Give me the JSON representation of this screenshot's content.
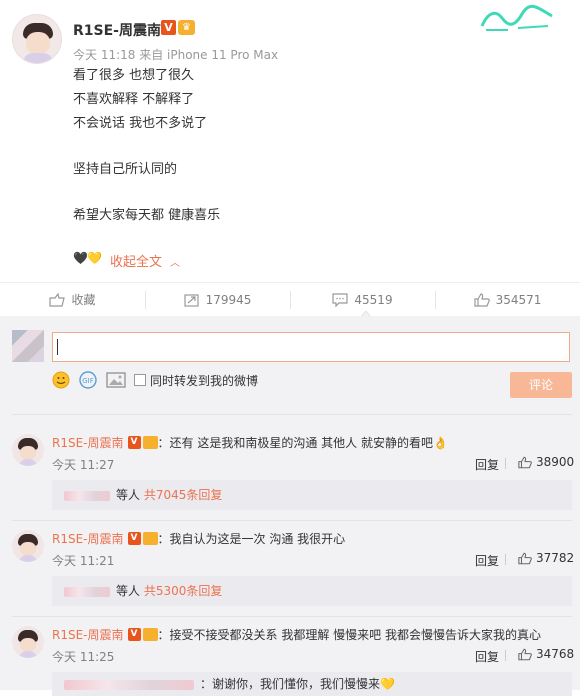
{
  "post": {
    "author": "R1SE-周震南",
    "verified_badge": "V",
    "meta": "今天 11:18 来自 iPhone 11 Pro Max",
    "lines": [
      "看了很多 也想了很久",
      "不喜欢解释 不解释了",
      "不会说话 我也不多说了",
      "",
      "坚持自己所认同的",
      "",
      "希望大家每天都 健康喜乐"
    ],
    "hearts": "🖤💛",
    "collapse_label": "收起全文"
  },
  "actions": {
    "favorite": "收藏",
    "repost": "179945",
    "comment": "45519",
    "like": "354571"
  },
  "composer": {
    "repost_label": "同时转发到我的微博",
    "submit_label": "评论"
  },
  "comments": [
    {
      "author": "R1SE-周震南",
      "text": "：还有 这是我和南极星的沟通 其他人 就安静的看吧👌",
      "time": "今天 11:27",
      "reply_label": "回复",
      "likes": "38900",
      "sub_suffix": "等人",
      "sub_count": "共7045条回复"
    },
    {
      "author": "R1SE-周震南",
      "text": "：我自认为这是一次 沟通 我很开心",
      "time": "今天 11:21",
      "reply_label": "回复",
      "likes": "37782",
      "sub_suffix": "等人",
      "sub_count": "共5300条回复"
    },
    {
      "author": "R1SE-周震南",
      "text": "：接受不接受都没关系 我都理解 慢慢来吧 我都会慢慢告诉大家我的真心",
      "time": "今天 11:25",
      "reply_label": "回复",
      "likes": "34768",
      "sub_text": "：谢谢你，我们懂你，我们慢慢来💛"
    }
  ],
  "colors": {
    "accent": "#eb7350",
    "verified": "#e8541d",
    "crown": "#f5b02e",
    "submit_bg": "#f8b898"
  }
}
